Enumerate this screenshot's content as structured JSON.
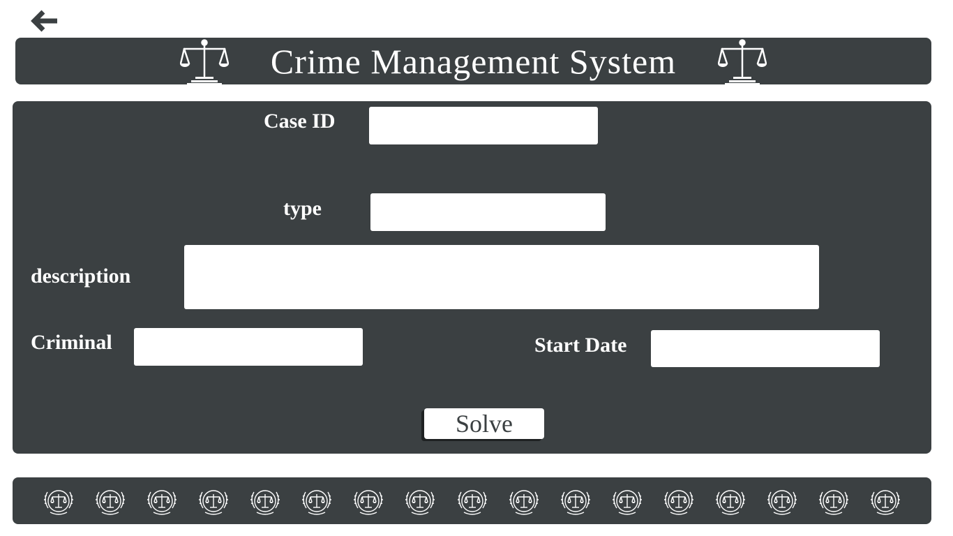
{
  "header": {
    "title": "Crime Management System",
    "left_icon": "scale-icon",
    "right_icon": "scale-icon"
  },
  "navigation": {
    "back_icon": "arrow-left-icon"
  },
  "form": {
    "case_id": {
      "label": "Case ID",
      "value": ""
    },
    "type": {
      "label": "type",
      "value": ""
    },
    "description": {
      "label": "description",
      "value": ""
    },
    "criminal": {
      "label": "Criminal",
      "value": ""
    },
    "start_date": {
      "label": "Start Date",
      "value": ""
    },
    "solve_label": "Solve"
  },
  "footer": {
    "icon": "justice-emblem-icon",
    "icon_count": 17
  },
  "colors": {
    "panel": "#3b4042",
    "text": "#ffffff",
    "page_background": "#ffffff"
  }
}
